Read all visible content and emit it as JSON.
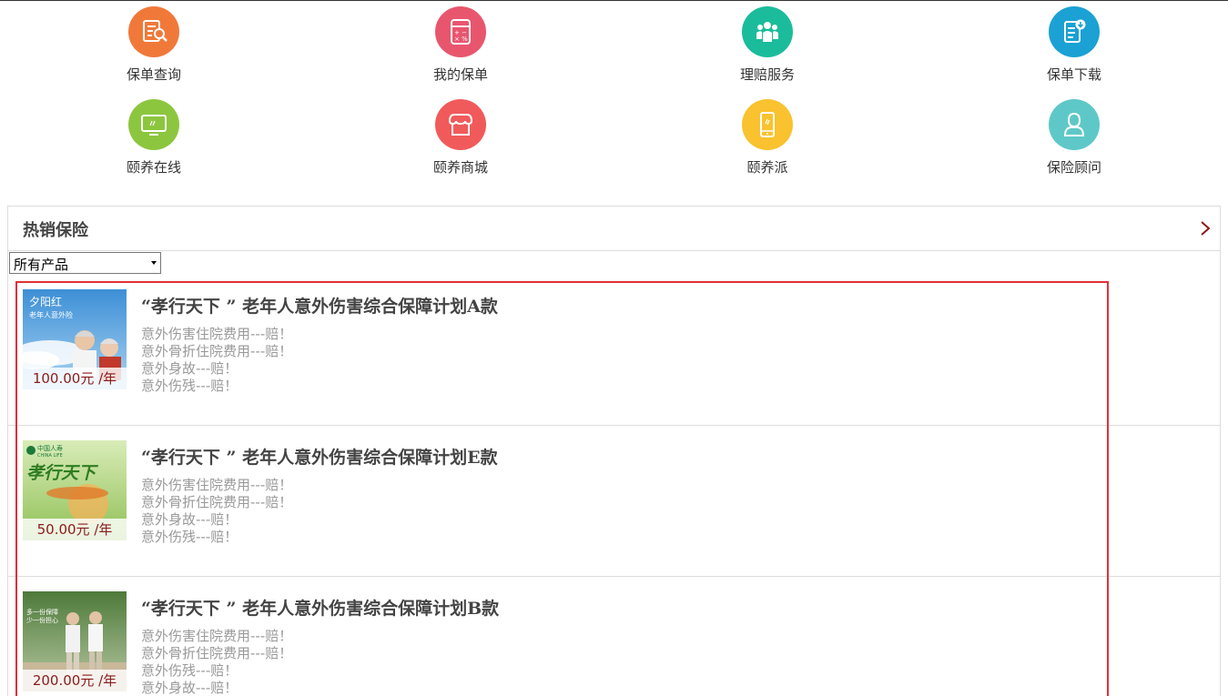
{
  "nav": {
    "items": [
      {
        "label": "保单查询",
        "icon": "policy-search-icon",
        "color": "#f0793a"
      },
      {
        "label": "我的保单",
        "icon": "calculator-icon",
        "color": "#e8566e"
      },
      {
        "label": "理赔服务",
        "icon": "group-people-icon",
        "color": "#1bbc9b"
      },
      {
        "label": "保单下载",
        "icon": "document-download-icon",
        "color": "#1ba1d4"
      },
      {
        "label": "颐养在线",
        "icon": "monitor-icon",
        "color": "#8cc63f"
      },
      {
        "label": "颐养商城",
        "icon": "shop-icon",
        "color": "#f15a5a"
      },
      {
        "label": "颐养派",
        "icon": "mobile-phone-icon",
        "color": "#f9c22e"
      },
      {
        "label": "保险顾问",
        "icon": "person-icon",
        "color": "#5ec8c8"
      }
    ]
  },
  "hot": {
    "title": "热销保险",
    "filter_value": "所有产品",
    "highlight_color": "#e0303a",
    "products": [
      {
        "title": "“孝行天下 ” 老年人意外伤害综合保障计划A款",
        "price": "100.00元 /年",
        "thumb_text_1": "夕阳红",
        "thumb_text_2": "老年人意外险",
        "features": [
          "意外伤害住院费用---赔！",
          "意外骨折住院费用---赔！",
          "意外身故---赔！",
          "意外伤残---赔！"
        ]
      },
      {
        "title": "“孝行天下 ” 老年人意外伤害综合保障计划E款",
        "price": "50.00元 /年",
        "thumb_text_1": "中国人寿",
        "thumb_text_2": "CHINA LIFE",
        "thumb_text_3": "孝行天下",
        "features": [
          "意外伤害住院费用---赔！",
          "意外骨折住院费用---赔！",
          "意外身故---赔！",
          "意外伤残---赔！"
        ]
      },
      {
        "title": "“孝行天下 ” 老年人意外伤害综合保障计划B款",
        "price": "200.00元 /年",
        "thumb_text_1": "多一份保障",
        "thumb_text_2": "少一份担心",
        "features": [
          "意外伤害住院费用---赔！",
          "意外骨折住院费用---赔！",
          "意外伤残---赔！",
          "意外身故---赔！"
        ]
      }
    ]
  }
}
